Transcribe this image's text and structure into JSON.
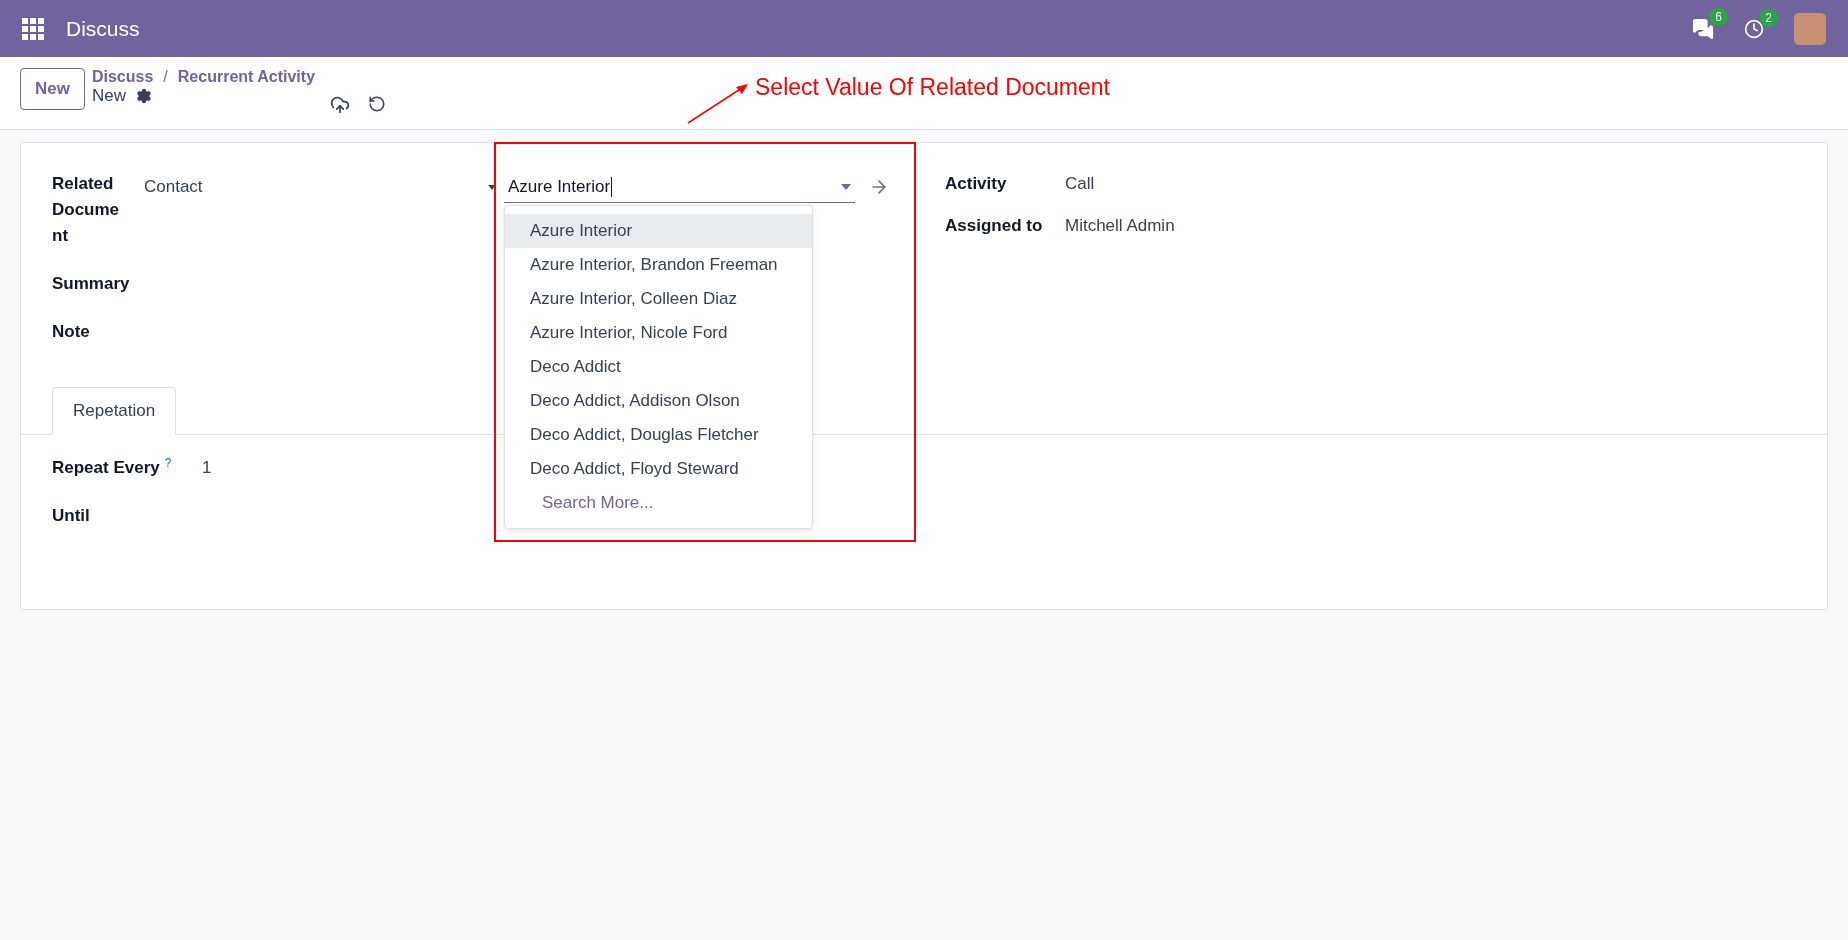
{
  "navbar": {
    "app_title": "Discuss",
    "messages_badge": "6",
    "activities_badge": "2"
  },
  "control_panel": {
    "new_button": "New",
    "breadcrumbs": [
      {
        "label": "Discuss"
      },
      {
        "label": "Recurrent Activity"
      }
    ],
    "separator": "/",
    "current": "New"
  },
  "annotation": {
    "text": "Select Value Of Related Document"
  },
  "form": {
    "left_fields": [
      {
        "kind": "reference",
        "label": "Related Document",
        "model": "Contact",
        "value": "Azure Interior"
      },
      {
        "kind": "empty",
        "label": "Summary"
      },
      {
        "kind": "empty",
        "label": "Note"
      }
    ],
    "right_fields": [
      {
        "label": "Activity",
        "value": "Call"
      },
      {
        "label": "Assigned to",
        "value": "Mitchell Admin"
      }
    ],
    "dropdown": {
      "options": [
        {
          "label": "Azure Interior",
          "selected": true
        },
        {
          "label": "Azure Interior, Brandon Freeman",
          "selected": false
        },
        {
          "label": "Azure Interior, Colleen Diaz",
          "selected": false
        },
        {
          "label": "Azure Interior, Nicole Ford",
          "selected": false
        },
        {
          "label": "Deco Addict",
          "selected": false
        },
        {
          "label": "Deco Addict, Addison Olson",
          "selected": false
        },
        {
          "label": "Deco Addict, Douglas Fletcher",
          "selected": false
        },
        {
          "label": "Deco Addict, Floyd Steward",
          "selected": false
        }
      ],
      "search_more": "Search More..."
    },
    "tabs": [
      {
        "label": "Repetation",
        "selected": true
      }
    ],
    "tab_fields": [
      {
        "label": "Repeat Every",
        "help": "?",
        "value": "1"
      },
      {
        "label": "Until"
      }
    ]
  }
}
